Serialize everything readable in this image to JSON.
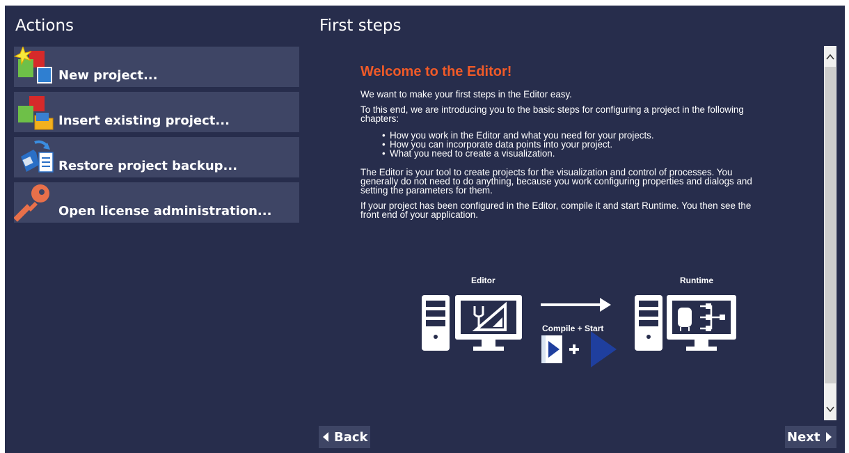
{
  "actions": {
    "title": "Actions",
    "items": [
      {
        "label": "New project...",
        "icon": "new-project-icon"
      },
      {
        "label": "Insert existing project...",
        "icon": "insert-project-icon"
      },
      {
        "label": "Restore project backup...",
        "icon": "restore-backup-icon"
      },
      {
        "label": "Open license administration...",
        "icon": "key-icon"
      }
    ]
  },
  "first_steps": {
    "title": "First steps",
    "heading": "Welcome to the Editor!",
    "intro": "We want to make your first steps in the Editor easy.",
    "intro2": "To this end, we are introducing you to the basic steps for configuring a project in the following chapters:",
    "bullets": [
      "How you work in the Editor and what you need for your projects.",
      "How you can incorporate data points into your project.",
      "What you need to create a visualization."
    ],
    "para3": "The Editor is your tool to create projects for the visualization and control of processes. You generally do not need to do anything, because you work configuring properties and dialogs and setting the parameters for them.",
    "para4": "If your project has been configured in the Editor, compile it and start Runtime. You then see the front end of your application.",
    "diagram": {
      "editor_label": "Editor",
      "runtime_label": "Runtime",
      "compile_label": "Compile + Start"
    }
  },
  "nav": {
    "back_label": "Back",
    "next_label": "Next"
  },
  "colors": {
    "background": "#272d4c",
    "button": "#3e4565",
    "heading": "#f05a28",
    "play_blue": "#1f3f9e"
  }
}
